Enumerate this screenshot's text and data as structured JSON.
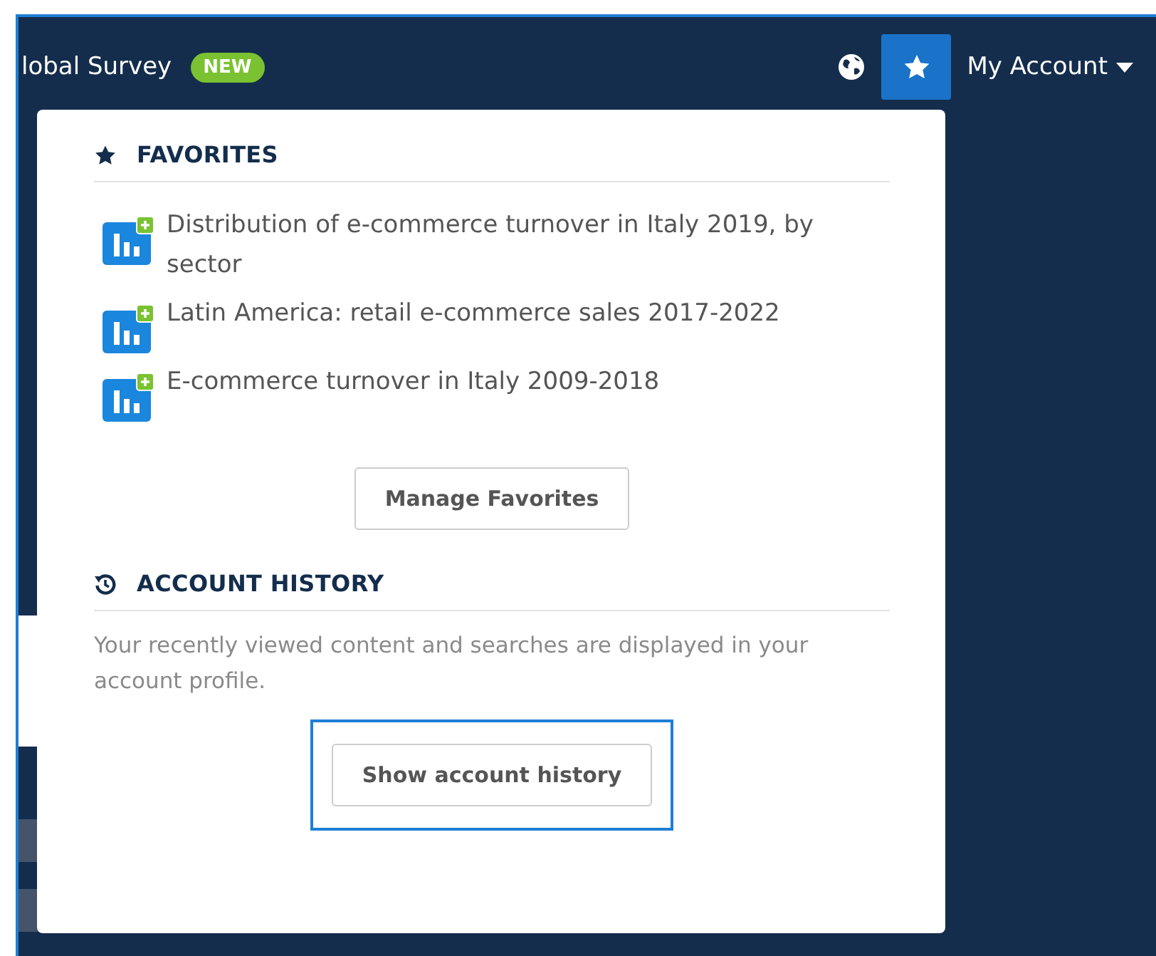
{
  "header": {
    "title": "lobal Survey",
    "badge": "NEW",
    "favorites_button": {
      "selected": true
    },
    "account_label": "My Account"
  },
  "favorites": {
    "title": "FAVORITES",
    "items": [
      {
        "label": "Distribution of e-commerce turnover in Italy 2019, by sector"
      },
      {
        "label": "Latin America: retail e-commerce sales 2017-2022"
      },
      {
        "label": "E-commerce turnover in Italy 2009-2018"
      }
    ],
    "button": "Manage Favorites"
  },
  "history": {
    "title": "ACCOUNT HISTORY",
    "description": "Your recently viewed content and searches are displayed in your account profile.",
    "button": "Show account history",
    "button_focused": true
  }
}
